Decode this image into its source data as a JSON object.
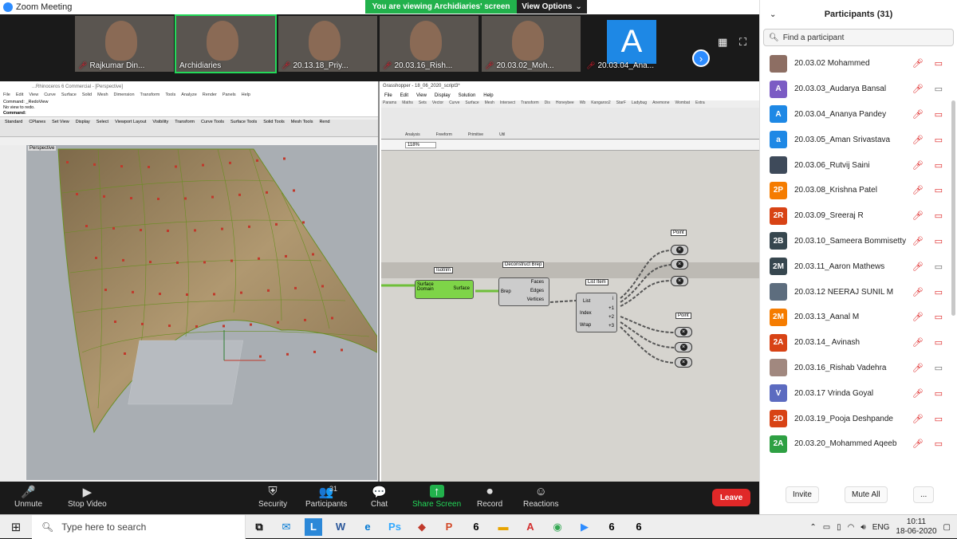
{
  "window": {
    "title": "Zoom Meeting"
  },
  "banner": {
    "message": "You are viewing Archidiaries' screen",
    "options": "View Options"
  },
  "gallery": [
    {
      "name": "Rajkumar Din...",
      "muted": true,
      "active": false,
      "avatar": false
    },
    {
      "name": "Archidiaries",
      "muted": false,
      "active": true,
      "avatar": false
    },
    {
      "name": "20.13.18_Priy...",
      "muted": true,
      "active": false,
      "avatar": false
    },
    {
      "name": "20.03.16_Rish...",
      "muted": true,
      "active": false,
      "avatar": false
    },
    {
      "name": "20.03.02_Moh...",
      "muted": true,
      "active": false,
      "avatar": false
    },
    {
      "name": "20.03.04_Ana...",
      "muted": true,
      "active": false,
      "avatar": true,
      "initial": "A"
    }
  ],
  "rhino": {
    "title": "...Rhinoceros 6 Commercial - [Perspective]",
    "menu": [
      "File",
      "Edit",
      "View",
      "Curve",
      "Surface",
      "Solid",
      "Mesh",
      "Dimension",
      "Transform",
      "Tools",
      "Analyze",
      "Render",
      "Panels",
      "Help"
    ],
    "cmd1": "Command: _RedoView",
    "cmd2": "No view to redo.",
    "cmd3": "Command:",
    "tabs": [
      "Standard",
      "CPlanes",
      "Set View",
      "Display",
      "Select",
      "Viewport Layout",
      "Visibility",
      "Transform",
      "Curve Tools",
      "Surface Tools",
      "Solid Tools",
      "Mesh Tools",
      "Rend"
    ],
    "viewport": "Perspective"
  },
  "grasshopper": {
    "title": "Grasshopper - 18_06_2020_script3*",
    "file": "18_06_2020_script3",
    "menu": [
      "File",
      "Edit",
      "View",
      "Display",
      "Solution",
      "Help"
    ],
    "tabs": [
      "Params",
      "Maths",
      "Sets",
      "Vector",
      "Curve",
      "Surface",
      "Mesh",
      "Intersect",
      "Transform",
      "Dis",
      "Honeybee",
      "Wb",
      "Kangaroo2",
      "StarF",
      "Ladybug",
      "Anemone",
      "Wombat",
      "Extra"
    ],
    "groups": [
      "Analysis",
      "Freeform",
      "Primitive",
      "Util"
    ],
    "zoom": "118%",
    "nodes": {
      "isotrim": {
        "label": "Isotrim",
        "in1": "Surface",
        "in2": "Domain",
        "out": "Surface"
      },
      "deconstruct": {
        "label": "Deconstruct Brep",
        "in": "Brep",
        "out1": "Faces",
        "out2": "Edges",
        "out3": "Vertices"
      },
      "listitem": {
        "label": "List Item",
        "in1": "List",
        "in2": "Index",
        "in3": "Wrap",
        "out0": "i",
        "out1": "+1",
        "out2": "+2",
        "out3": "+3"
      },
      "point1": "Point",
      "point2": "Point"
    }
  },
  "controls": [
    {
      "label": "Unmute",
      "icon": "🎤"
    },
    {
      "label": "Stop Video",
      "icon": "▶"
    },
    {
      "label": "Security",
      "icon": "⛨"
    },
    {
      "label": "Participants",
      "icon": "👥",
      "count": "31"
    },
    {
      "label": "Chat",
      "icon": "💬"
    },
    {
      "label": "Share Screen",
      "icon": "↑"
    },
    {
      "label": "Record",
      "icon": "⏺"
    },
    {
      "label": "Reactions",
      "icon": "☺"
    }
  ],
  "leave": "Leave",
  "participants": {
    "title": "Participants (31)",
    "search_placeholder": "Find a participant",
    "list": [
      {
        "name": "20.03.02 Mohammed",
        "initial": "",
        "color": "#8d6e63",
        "cam_on": false
      },
      {
        "name": "20.03.03_Audarya Bansal",
        "initial": "A",
        "color": "#7b5cc4",
        "cam_on": true
      },
      {
        "name": "20.03.04_Ananya Pandey",
        "initial": "A",
        "color": "#1e88e5",
        "cam_on": false
      },
      {
        "name": "20.03.05_Aman Srivastava",
        "initial": "a",
        "color": "#1e88e5",
        "cam_on": false
      },
      {
        "name": "20.03.06_Rutvij Saini",
        "initial": "",
        "color": "#3e4a5a",
        "cam_on": false
      },
      {
        "name": "20.03.08_Krishna Patel",
        "initial": "2P",
        "color": "#f57c00",
        "cam_on": false
      },
      {
        "name": "20.03.09_Sreeraj R",
        "initial": "2R",
        "color": "#d84315",
        "cam_on": false
      },
      {
        "name": "20.03.10_Sameera Bommisetty",
        "initial": "2B",
        "color": "#37474f",
        "cam_on": false
      },
      {
        "name": "20.03.11_Aaron Mathews",
        "initial": "2M",
        "color": "#37474f",
        "cam_on": true
      },
      {
        "name": "20.03.12 NEERAJ SUNIL M",
        "initial": "",
        "color": "#5d6d7e",
        "cam_on": false
      },
      {
        "name": "20.03.13_Aanal M",
        "initial": "2M",
        "color": "#f57c00",
        "cam_on": false
      },
      {
        "name": "20.03.14_ Avinash",
        "initial": "2A",
        "color": "#d84315",
        "cam_on": false
      },
      {
        "name": "20.03.16_Rishab Vadehra",
        "initial": "",
        "color": "#a1887f",
        "cam_on": true
      },
      {
        "name": "20.03.17 Vrinda Goyal",
        "initial": "V",
        "color": "#5c6bc0",
        "cam_on": false
      },
      {
        "name": "20.03.19_Pooja Deshpande",
        "initial": "2D",
        "color": "#d84315",
        "cam_on": false
      },
      {
        "name": "20.03.20_Mohammed Aqeeb",
        "initial": "2A",
        "color": "#2ea043",
        "cam_on": false
      }
    ],
    "invite": "Invite",
    "mute_all": "Mute All",
    "more": "..."
  },
  "taskbar": {
    "search_placeholder": "Type here to search",
    "lang": "ENG",
    "time": "10:11",
    "date": "18-06-2020"
  }
}
